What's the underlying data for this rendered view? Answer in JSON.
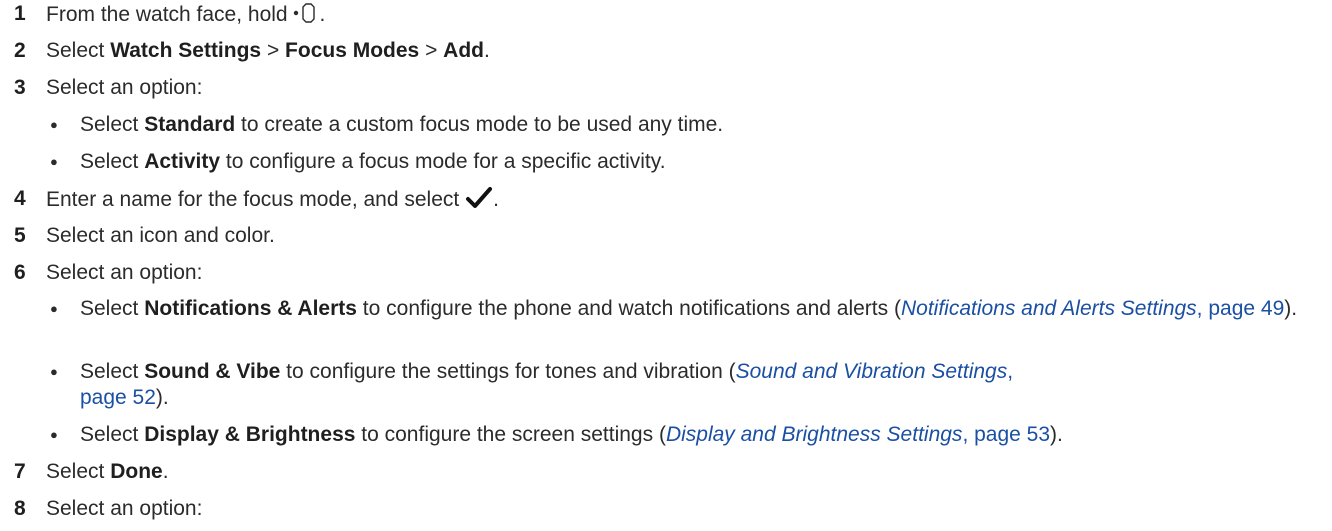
{
  "steps": [
    {
      "num": "1",
      "pre": "From the watch face, hold ",
      "icon": "watch-button-icon",
      "post": "."
    },
    {
      "num": "2",
      "pre": "Select ",
      "b1": "Watch Settings",
      "sep1": " > ",
      "b2": "Focus Modes",
      "sep2": " > ",
      "b3": "Add",
      "post": "."
    },
    {
      "num": "3",
      "text": "Select an option:",
      "bullets": [
        {
          "pre": "Select ",
          "bold": "Standard",
          "post": " to create a custom focus mode to be used any time."
        },
        {
          "pre": "Select ",
          "bold": "Activity",
          "post": " to configure a focus mode for a specific activity."
        }
      ]
    },
    {
      "num": "4",
      "pre": "Enter a name for the focus mode, and select ",
      "icon": "checkmark-icon",
      "post": "."
    },
    {
      "num": "5",
      "text": "Select an icon and color."
    },
    {
      "num": "6",
      "text": "Select an option:",
      "bullets": [
        {
          "pre": "Select ",
          "bold": "Notifications & Alerts",
          "post": " to configure the phone and watch notifications and alerts (",
          "link_title": "Notifications and Alerts Settings",
          "link_page": ", page 49",
          "end": ")."
        },
        {
          "pre": "Select ",
          "bold": "Sound & Vibe",
          "post": " to configure the settings for tones and vibration (",
          "link_title": "Sound and Vibration Settings",
          "link_page": ", page 52",
          "end": ")."
        },
        {
          "pre": "Select ",
          "bold": "Display & Brightness",
          "post": " to configure the screen settings (",
          "link_title": "Display and Brightness Settings",
          "link_page": ", page 53",
          "end": ")."
        }
      ]
    },
    {
      "num": "7",
      "pre": "Select ",
      "b1": "Done",
      "post": "."
    },
    {
      "num": "8",
      "text": "Select an option:"
    }
  ],
  "colors": {
    "text": "#2b2b2b",
    "link": "#1a4fa3"
  }
}
